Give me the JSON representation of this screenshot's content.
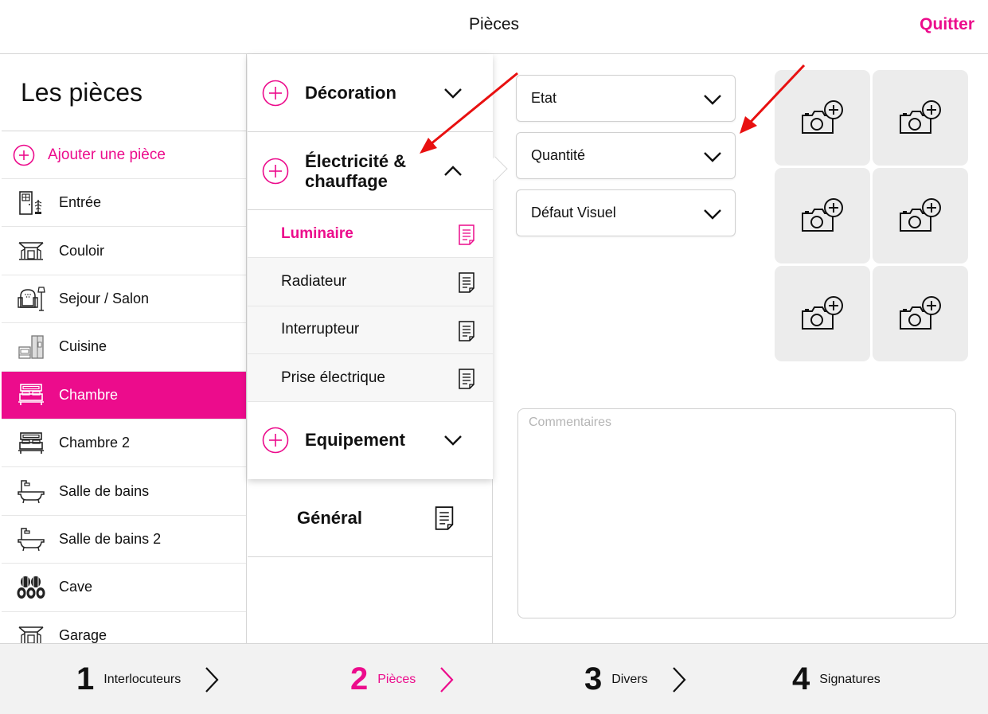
{
  "header": {
    "title": "Pièces",
    "quit_label": "Quitter"
  },
  "sidebar": {
    "heading": "Les pièces",
    "add_room_label": "Ajouter une pièce",
    "rooms": [
      {
        "label": "Entrée",
        "icon": "door-icon"
      },
      {
        "label": "Couloir",
        "icon": "hallway-icon"
      },
      {
        "label": "Sejour / Salon",
        "icon": "armchair-icon"
      },
      {
        "label": "Cuisine",
        "icon": "kitchen-icon"
      },
      {
        "label": "Chambre",
        "icon": "bed-icon",
        "active": true
      },
      {
        "label": "Chambre 2",
        "icon": "bed-icon"
      },
      {
        "label": "Salle de bains",
        "icon": "bathtub-icon"
      },
      {
        "label": "Salle de bains 2",
        "icon": "bathtub-icon"
      },
      {
        "label": "Cave",
        "icon": "barrels-icon"
      },
      {
        "label": "Garage",
        "icon": "garage-icon"
      }
    ]
  },
  "categories": {
    "decoration": {
      "label": "Décoration",
      "expanded": false
    },
    "electricite": {
      "label": "Électricité & chauffage",
      "expanded": true,
      "items": [
        {
          "label": "Luminaire",
          "active": true
        },
        {
          "label": "Radiateur"
        },
        {
          "label": "Interrupteur"
        },
        {
          "label": "Prise électrique"
        }
      ]
    },
    "equipement": {
      "label": "Equipement",
      "expanded": false
    },
    "general": {
      "label": "Général"
    }
  },
  "form": {
    "dropdowns": [
      {
        "label": "Etat"
      },
      {
        "label": "Quantité"
      },
      {
        "label": "Défaut Visuel"
      }
    ],
    "photo_slots": 6,
    "comments_placeholder": "Commentaires"
  },
  "steps": [
    {
      "num": "1",
      "label": "Interlocuteurs"
    },
    {
      "num": "2",
      "label": "Pièces",
      "active": true
    },
    {
      "num": "3",
      "label": "Divers"
    },
    {
      "num": "4",
      "label": "Signatures"
    }
  ],
  "colors": {
    "accent": "#ec0c8c",
    "annotation": "#e81010",
    "photo_bg": "#ececec",
    "footer_bg": "#f2f2f2"
  }
}
